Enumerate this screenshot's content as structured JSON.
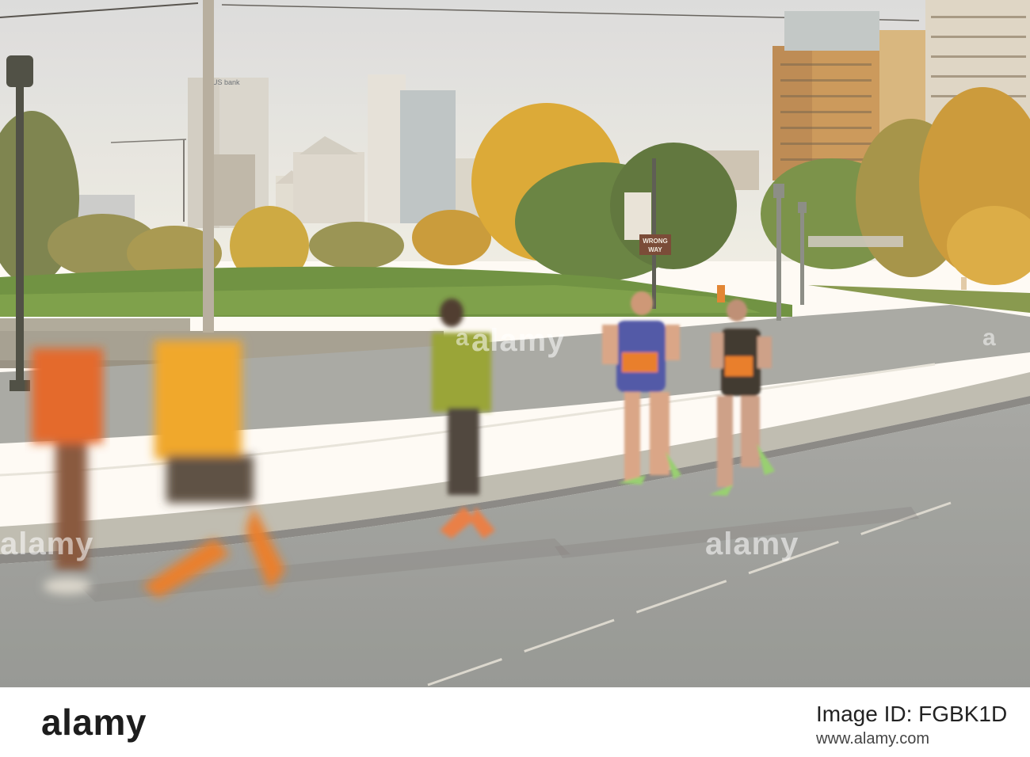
{
  "photo": {
    "sign_text_line1": "WRONG",
    "sign_text_line2": "WAY",
    "tower_logo": "US bank"
  },
  "watermark": {
    "center": "alamy",
    "left": "alamy",
    "right": "alamy"
  },
  "footer": {
    "logo": "alamy",
    "image_id": "Image ID: FGBK1D",
    "url": "www.alamy.com"
  }
}
